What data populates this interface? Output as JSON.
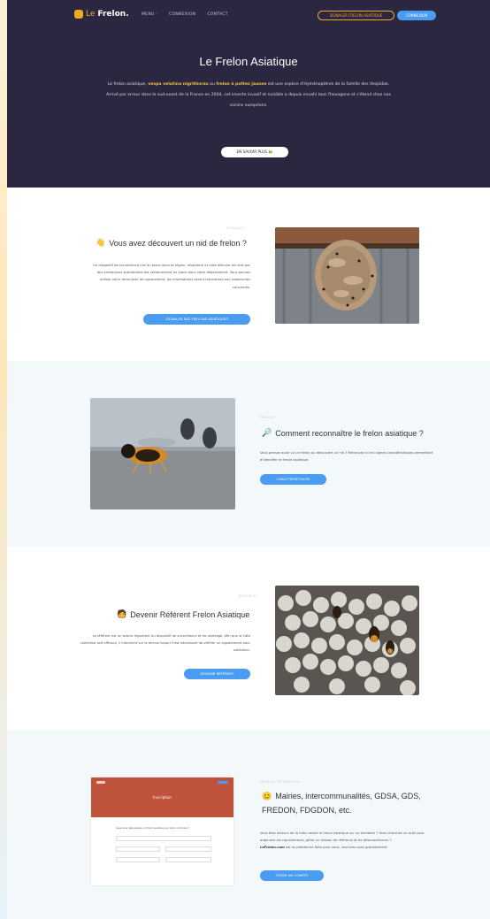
{
  "nav": {
    "brand_prefix": "Le",
    "brand_suffix": "Frelon.",
    "links": [
      "Menu ·",
      "Connexion",
      "Contact"
    ],
    "report_button": "Signaler frelon asiatique",
    "login_button": "Connexion"
  },
  "hero": {
    "title": "Le Frelon Asiatique",
    "text_pre": "Le frelon asiatique,",
    "text_b1": "vespa velutina nigrithorax",
    "text_mid": "ou",
    "text_b2": "frelon à pattes jaunes",
    "text_post": "est une espèce d'Hyménoptères de la famille des Vespidae. Arrivé par erreur dans le sud-ouest de la France en 2004, cet insecte invasif et nuisible a depuis envahi tout l'hexagone et s'étend chez nos voisins européens.",
    "button": "En savoir plus 🐝"
  },
  "sections": [
    {
      "kicker": "Signaler",
      "icon": "👋",
      "title": "Vous avez découvert un nid de frelon ?",
      "text": "Un dispositif de surveillance mis en place dans ta région, répertorie et lutte détruire les nids par des entreprises spécialisées est certainement en place dans votre département. Vous pouvez utiliser notre formulaire de signalement, les informations seront transmises aux organismes concernés.",
      "button": "Signaler des frelons asiatiques",
      "photo": "hornet nest"
    },
    {
      "kicker": "Frelon",
      "icon": "🔎",
      "title": "Comment reconnaître le frelon asiatique ?",
      "text": "Vous pensez avoir vu un frelon ou découvert un nid ? Retrouvez ici les signes caractéristiques permettant d'identifier le frelon asiatique.",
      "button": "Caractéristiques",
      "photo": "asian hornet"
    },
    {
      "kicker": "Référent",
      "icon": "🧑",
      "title": "Devenir Référent Frelon Asiatique",
      "text": "Le référent est un acteur important du dispositif de surveillance et du repérage. Afin que la lutte collective soit efficace, il intervient sur le terrain lorsqu'il est nécessaire de vérifier un signalement pour validation.",
      "button": "Devenir référent",
      "photo": "hornet comb"
    },
    {
      "kicker": "Mairies, référents",
      "icon": "😊",
      "title": "Mairies, intercommunalités, GDSA, GDS, FREDON, FDGDON, etc.",
      "title_line1": "Mairies, intercommunalités, GDSA, GDS,",
      "title_line2": "FREDON, FDGDON, etc.",
      "text_1": "Vous êtes acteurs de la lutte contre le frelon asiatique sur un territoire ? Vous cherchez un outil pour organiser les signalements, gérer un réseau de référents et de désinsectiseurs ?",
      "text_brand": "LeFrelon.com",
      "text_2": "est la plateforme faite pour vous, inscrivez-vous gratuitement.",
      "button": "Créer un compte",
      "mock": {
        "header_text": "Inscription",
        "form_question": "Avez-vous déjà signalé un frelon asiatique sur votre commune ?"
      }
    }
  ],
  "colors": {
    "hero_bg": "#2b2740",
    "accent": "#f0a828",
    "primary": "#4a9cf0",
    "alt_section_bg": "#f3f8fa"
  }
}
